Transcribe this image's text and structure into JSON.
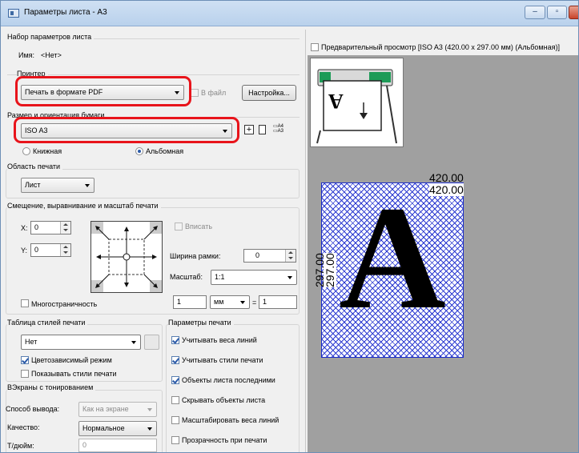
{
  "window": {
    "title": "Параметры листа - A3",
    "minimize": "‒",
    "maximize": "▫",
    "close": "x"
  },
  "page_setup": {
    "group": "Набор параметров листа",
    "name_label": "Имя:",
    "name_value": "<Нет>"
  },
  "printer": {
    "group": "Принтер",
    "device": "Печать в формате PDF",
    "to_file_label": "В файл",
    "settings_button": "Настройка..."
  },
  "paper": {
    "group": "Размер и ориентация бумаги",
    "size": "ISO A3",
    "portrait_label": "Книжная",
    "landscape_label": "Альбомная",
    "orientation": "landscape"
  },
  "plot_area": {
    "group": "Область печати",
    "what_to_plot": "Лист"
  },
  "offset": {
    "group": "Смещение, выравнивание и масштаб печати",
    "x_label": "X:",
    "x_value": "0",
    "y_label": "Y:",
    "y_value": "0",
    "fit_label": "Вписать",
    "margin_label": "Ширина рамки:",
    "margin_value": "0",
    "scale_label": "Масштаб:",
    "scale_value": "1:1",
    "ratio_left": "1",
    "ratio_unit": "мм",
    "ratio_eq": "=",
    "ratio_right": "1",
    "multipage_label": "Многостраничность"
  },
  "plot_style": {
    "group": "Таблица стилей печати",
    "table": "Нет",
    "color_dependent_label": "Цветозависимый режим",
    "color_dependent": true,
    "show_styles_label": "Показывать стили печати",
    "show_styles": false
  },
  "shaded": {
    "group": "ВЭкраны с тонированием",
    "output_label": "Способ вывода:",
    "output_value": "Как на экране",
    "quality_label": "Качество:",
    "quality_value": "Нормальное",
    "dpi_label": "Т/дюйм:",
    "dpi_value": "0"
  },
  "plot_options": {
    "group": "Параметры печати",
    "items": [
      {
        "label": "Учитывать веса линий",
        "checked": true
      },
      {
        "label": "Учитывать стили печати",
        "checked": true
      },
      {
        "label": "Объекты листа последними",
        "checked": true
      },
      {
        "label": "Скрывать объекты листа",
        "checked": false
      },
      {
        "label": "Масштабировать веса линий",
        "checked": false
      },
      {
        "label": "Прозрачность при печати",
        "checked": false
      }
    ]
  },
  "preview": {
    "checkbox_label": "Предварительный просмотр [ISO A3 (420.00 x 297.00 мм) (Альбомная)]",
    "width_outer": "420.00",
    "width_inner": "420.00",
    "height_outer": "297.00",
    "height_inner": "297.00",
    "sheet_letter": "A",
    "icon_letter": "A"
  },
  "colors": {
    "highlight": "#e8141b",
    "hatch": "#2a38d0",
    "preview_bg": "#a0a0a0"
  }
}
